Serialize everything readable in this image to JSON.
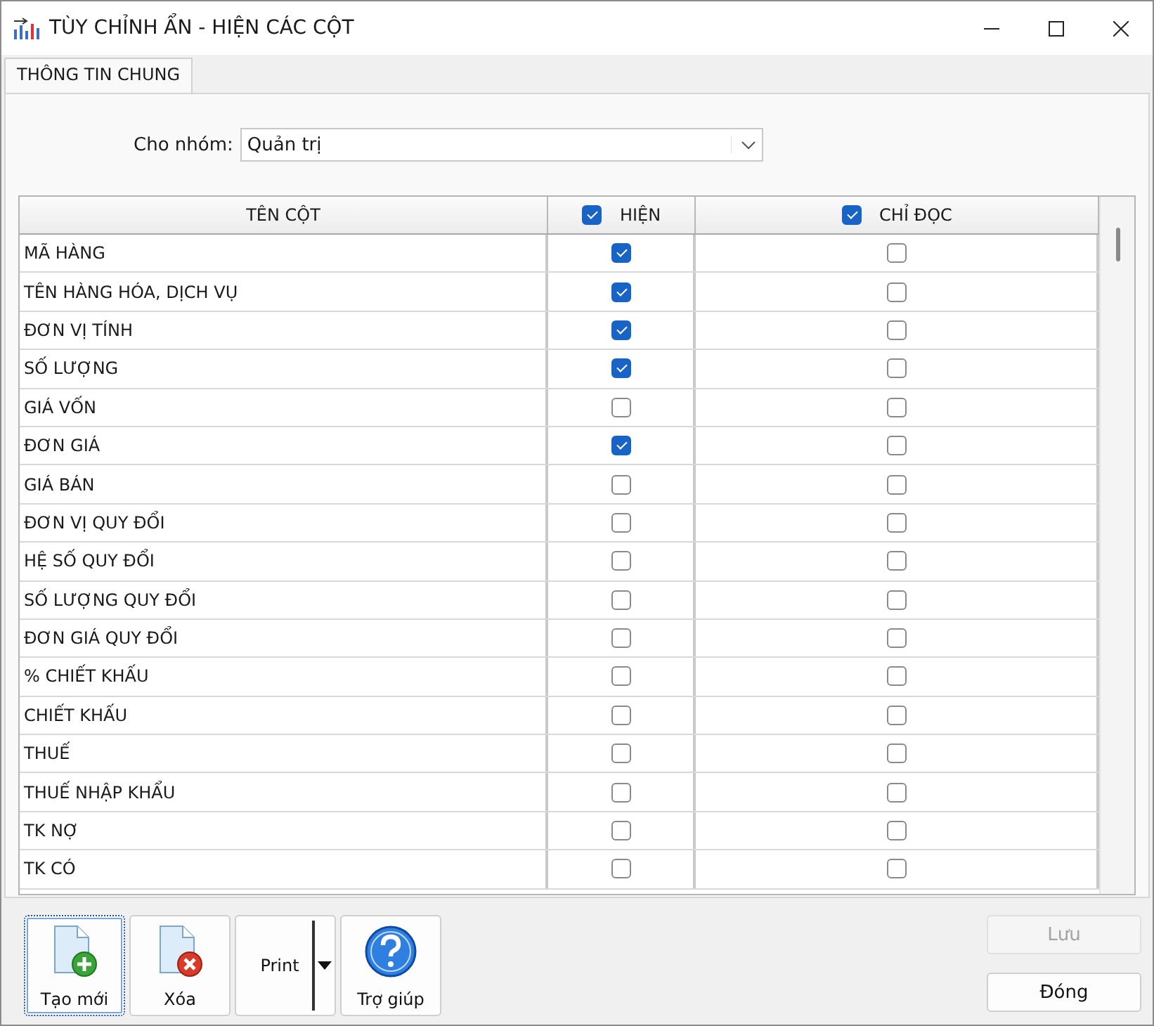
{
  "window": {
    "title": "TÙY CHỈNH ẨN - HIỆN CÁC CỘT"
  },
  "tabs": [
    {
      "label": "THÔNG TIN CHUNG",
      "selected": true
    }
  ],
  "group": {
    "label": "Cho nhóm:",
    "value": "Quản trị"
  },
  "table": {
    "columns": [
      {
        "label": "TÊN CỘT",
        "kind": "text"
      },
      {
        "label": "HIỆN",
        "kind": "check",
        "checked": true
      },
      {
        "label": "CHỈ ĐỌC",
        "kind": "check",
        "checked": true
      }
    ],
    "rows": [
      {
        "name": "MÃ HÀNG",
        "show": true,
        "readonly": false
      },
      {
        "name": "TÊN HÀNG HÓA, DỊCH VỤ",
        "show": true,
        "readonly": false
      },
      {
        "name": "ĐƠN VỊ TÍNH",
        "show": true,
        "readonly": false
      },
      {
        "name": "SỐ LƯỢNG",
        "show": true,
        "readonly": false
      },
      {
        "name": "GIÁ VỐN",
        "show": false,
        "readonly": false
      },
      {
        "name": "ĐƠN GIÁ",
        "show": true,
        "readonly": false
      },
      {
        "name": "GIÁ BÁN",
        "show": false,
        "readonly": false
      },
      {
        "name": "ĐƠN VỊ QUY ĐỔI",
        "show": false,
        "readonly": false
      },
      {
        "name": "HỆ SỐ QUY ĐỔI",
        "show": false,
        "readonly": false
      },
      {
        "name": "SỐ LƯỢNG QUY ĐỔI",
        "show": false,
        "readonly": false
      },
      {
        "name": "ĐƠN GIÁ QUY ĐỔI",
        "show": false,
        "readonly": false
      },
      {
        "name": "% CHIẾT KHẤU",
        "show": false,
        "readonly": false
      },
      {
        "name": "CHIẾT KHẤU",
        "show": false,
        "readonly": false
      },
      {
        "name": "THUẾ",
        "show": false,
        "readonly": false
      },
      {
        "name": "THUẾ NHẬP KHẨU",
        "show": false,
        "readonly": false
      },
      {
        "name": "TK NỢ",
        "show": false,
        "readonly": false
      },
      {
        "name": "TK CÓ",
        "show": false,
        "readonly": false
      }
    ]
  },
  "toolbar": [
    {
      "label": "Tạo mới",
      "kind": "new",
      "focused": true
    },
    {
      "label": "Xóa",
      "kind": "delete",
      "focused": false
    },
    {
      "label": "Print",
      "kind": "split",
      "focused": false
    },
    {
      "label": "Trợ giúp",
      "kind": "help",
      "focused": false
    }
  ],
  "actions": [
    {
      "label": "Lưu",
      "disabled": true
    },
    {
      "label": "Đóng",
      "disabled": false
    }
  ]
}
